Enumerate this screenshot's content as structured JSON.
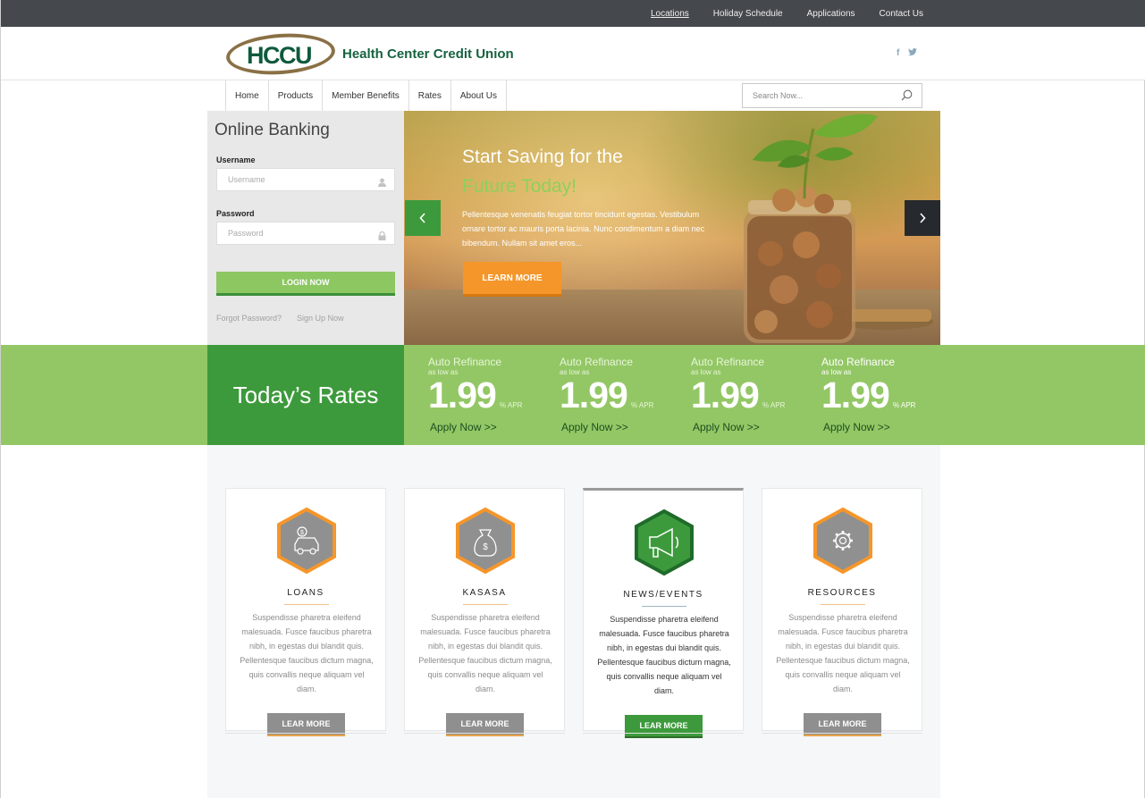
{
  "topbar": {
    "links": [
      {
        "label": "Locations",
        "active": true
      },
      {
        "label": "Holiday Schedule"
      },
      {
        "label": "Applications"
      },
      {
        "label": "Contact Us"
      }
    ]
  },
  "header": {
    "logo_text": "HCCU",
    "brand_name": "Health Center Credit Union",
    "social": {
      "facebook": "f",
      "twitter": "t"
    }
  },
  "nav": {
    "items": [
      "Home",
      "Products",
      "Member Benefits",
      "Rates",
      "About Us"
    ],
    "search_placeholder": "Search Now..."
  },
  "login": {
    "title": "Online Banking",
    "username_label": "Username",
    "username_placeholder": "Username",
    "password_label": "Password",
    "password_placeholder": "Password",
    "button": "LOGIN NOW",
    "forgot": "Forgot Password?",
    "signup": "Sign Up Now"
  },
  "hero": {
    "title_line1": "Start Saving for the",
    "title_line2": "Future Today!",
    "body": "Pellentesque venenatis feugiat tortor tincidunt egestas. Vestibulum ornare tortor ac mauris porta lacinia. Nunc condimentum a diam nec bibendum. Nullam sit amet eros...",
    "button": "LEARN MORE",
    "prev_icon": "chevron-left-icon",
    "next_icon": "chevron-right-icon"
  },
  "rates": {
    "title": "Today’s Rates",
    "items": [
      {
        "name": "Auto Refinance",
        "as_low": "as low as",
        "value": "1.99",
        "unit": "% APR",
        "link": "Apply Now >>"
      },
      {
        "name": "Auto Refinance",
        "as_low": "as low as",
        "value": "1.99",
        "unit": "% APR",
        "link": "Apply Now >>"
      },
      {
        "name": "Auto Refinance",
        "as_low": "as low as",
        "value": "1.99",
        "unit": "% APR",
        "link": "Apply Now >>"
      },
      {
        "name": "Auto Refinance",
        "as_low": "as low as",
        "value": "1.99",
        "unit": "% APR",
        "link": "Apply Now >>"
      }
    ]
  },
  "cards": [
    {
      "title": "LOANS",
      "icon": "car-loan-icon",
      "body": "Suspendisse pharetra eleifend malesuada. Fusce faucibus pharetra nibh, in egestas dui blandit quis. Pellentesque faucibus dictum magna, quis convallis neque aliquam vel diam.",
      "button": "LEAR MORE"
    },
    {
      "title": "KASASA",
      "icon": "money-bag-icon",
      "body": "Suspendisse pharetra eleifend malesuada. Fusce faucibus pharetra nibh, in egestas dui blandit quis. Pellentesque faucibus dictum magna, quis convallis neque aliquam vel diam.",
      "button": "LEAR MORE"
    },
    {
      "title": "NEWS/EVENTS",
      "icon": "megaphone-icon",
      "body": "Suspendisse pharetra eleifend malesuada. Fusce faucibus pharetra nibh, in egestas dui blandit quis. Pellentesque faucibus dictum magna, quis convallis neque aliquam vel diam.",
      "button": "LEAR MORE",
      "active": true
    },
    {
      "title": "RESOURCES",
      "icon": "gear-icon",
      "body": "Suspendisse pharetra eleifend malesuada. Fusce faucibus pharetra nibh, in egestas dui blandit quis. Pellentesque faucibus dictum magna, quis convallis neque aliquam vel diam.",
      "button": "LEAR MORE"
    }
  ],
  "colors": {
    "topbar": "#45484d",
    "brand_green": "#16633f",
    "accent_green": "#3d9a3c",
    "light_green": "#93c765",
    "orange": "#f5962a"
  }
}
